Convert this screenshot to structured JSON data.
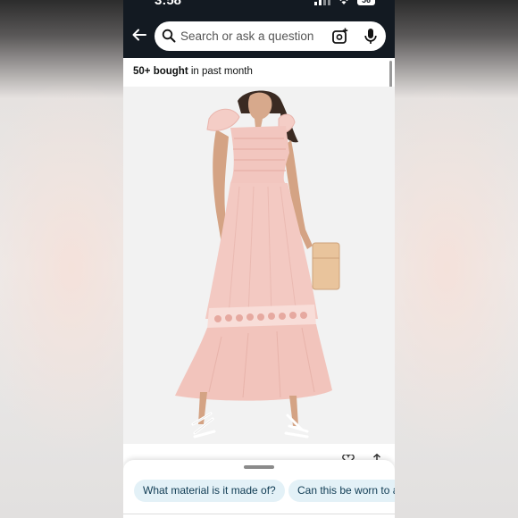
{
  "status_bar": {
    "time": "3:58",
    "battery": "56"
  },
  "header": {
    "search": {
      "placeholder": "Search or ask a question"
    },
    "icons": [
      "back-arrow-icon",
      "search-icon",
      "camera-lens-icon",
      "microphone-icon"
    ]
  },
  "product": {
    "bought_count": "50+ bought",
    "bought_suffix": " in past month",
    "image_alt_colors": {
      "dress": "#f2c9c4",
      "background": "#f2f2f2",
      "clutch": "#e9c49c"
    }
  },
  "actions": {
    "icons": [
      "heart-icon",
      "share-icon"
    ]
  },
  "suggestions": {
    "chips": [
      {
        "label": "What material is it made of?"
      },
      {
        "label": "Can this be worn to a"
      }
    ]
  },
  "colors": {
    "header_bg": "#131a22",
    "chip_bg": "#e3f1f7",
    "chip_text": "#0f3b53"
  }
}
